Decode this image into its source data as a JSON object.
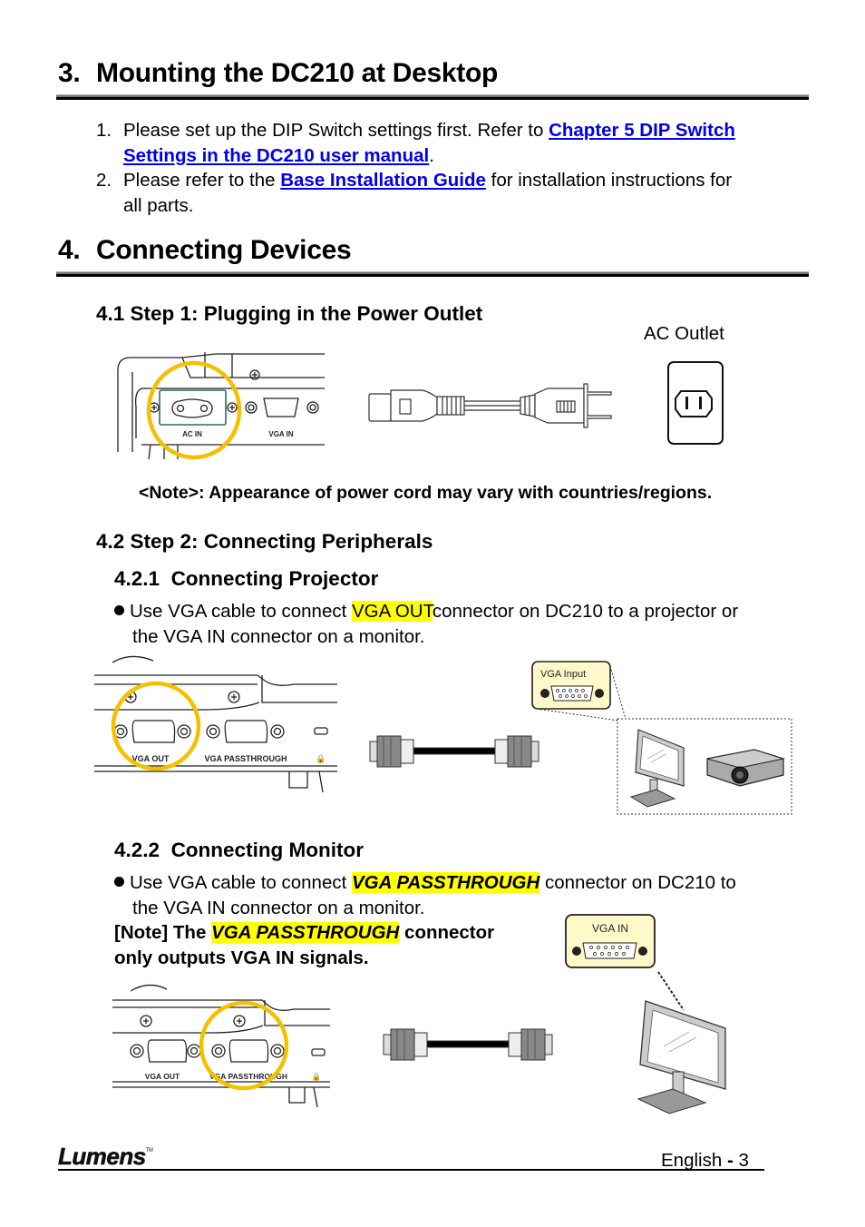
{
  "section3": {
    "number": "3.",
    "title": "Mounting the DC210 at Desktop",
    "items": [
      {
        "num": "1.",
        "text_before": "Please set up the DIP Switch settings first. Refer to ",
        "link_line1": "Chapter 5 DIP Switch ",
        "link_line2": "Settings in the DC210 user manual",
        "text_after": "."
      },
      {
        "num": "2.",
        "text_before": "Please refer to the ",
        "link": "Base Installation Guide",
        "text_after_line1": " for installation instructions for",
        "text_after_line2": "all parts."
      }
    ]
  },
  "section4": {
    "number": "4.",
    "title": "Connecting Devices",
    "step1": {
      "title": "4.1 Step 1: Plugging in the Power Outlet",
      "outlet_label": "AC Outlet",
      "device_labels": {
        "ac_in": "AC IN",
        "vga_in": "VGA IN"
      },
      "note": "<Note>: Appearance of power cord may vary with countries/regions."
    },
    "step2": {
      "title": "4.2 Step 2: Connecting Peripherals",
      "projector": {
        "title_num": "4.2.1",
        "title": "Connecting Projector",
        "text_before": "Use VGA cable to connect ",
        "highlight": "VGA OUT",
        "text_after_line1": "connector on DC210 to a projector or",
        "text_line2": "the VGA IN connector on a monitor.",
        "device_labels": {
          "vga_out": "VGA OUT",
          "vga_passthrough": "VGA PASSTHROUGH"
        },
        "callout_label": "VGA Input"
      },
      "monitor": {
        "title_num": "4.2.2",
        "title": "Connecting Monitor",
        "text_before": "Use VGA cable to connect ",
        "highlight": "VGA PASSTHROUGH",
        "text_after_line1": " connector on DC210 to",
        "text_line2": "the VGA IN connector on a monitor.",
        "note_prefix": "[Note] The ",
        "note_highlight": "VGA PASSTHROUGH",
        "note_suffix": " connector",
        "note_line2": "only outputs VGA IN signals.",
        "device_labels": {
          "vga_out": "VGA OUT",
          "vga_passthrough": "VGA PASSTHROUGH"
        },
        "callout_label": "VGA IN"
      }
    }
  },
  "footer": {
    "logo": "Lumens",
    "trademark": "TM",
    "page_label": "English",
    "separator": "-",
    "page_number": "3"
  },
  "colors": {
    "link": "#0000ee",
    "highlight": "#ffff00",
    "circle": "#f5c000",
    "callout_fill": "#fff8c8"
  }
}
